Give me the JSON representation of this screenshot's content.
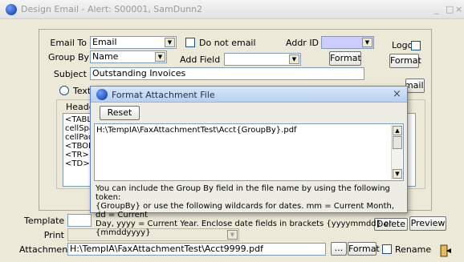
{
  "window": {
    "title": "Design Email - Alert: S00001, SamDunn2",
    "controls": [
      "_",
      "□",
      "×"
    ]
  },
  "form": {
    "email_to_label": "Email To",
    "email_to_value": "Email",
    "do_not_email_label": "Do not email",
    "addr_id_label": "Addr ID",
    "addr_id_value": "",
    "logo_label": "Logo",
    "logo_format_label": "Format",
    "group_by_label": "Group  By",
    "group_by_value": "Name",
    "add_field_label": "Add Field",
    "add_field_value": "",
    "add_field_format_label": "Format",
    "subject_label": "Subject",
    "subject_value": "Outstanding Invoices",
    "text_radio_label": "Text",
    "email_from_label": "Email From",
    "header_label": "Header",
    "header_lines": [
      "<TABL",
      "cellSpa",
      "cellPad",
      "<TBOD",
      "<TR>",
      "<TD><"
    ],
    "template_label": "Template",
    "template_value": "",
    "delete_label": "Delete",
    "preview_label": "Preview",
    "print_label": "Print",
    "print_value": "",
    "attachment_label": "Attachment",
    "attachment_value": "H:\\TempIA\\FaxAttachmentTest\\Acct9999.pdf",
    "attachment_browse_label": "...",
    "attachment_format_label": "Format",
    "rename_label": "Rename"
  },
  "dialog": {
    "title": "Format Attachment File",
    "close_label": "×",
    "reset_label": "Reset",
    "path_value": "H:\\TempIA\\FaxAttachmentTest\\Acct{GroupBy}.pdf",
    "help_text": "You can include the Group By field in the file name by using the following token:\n{GroupBy} or use the following wildcards for dates.  mm = Current Month, dd = Current\nDay, yyyy = Current Year.   Enclose date fields in brackets {yyyymmdd} or {mmddyyyy}"
  },
  "icons": {
    "app": "app-icon",
    "exit": "exit-icon"
  }
}
